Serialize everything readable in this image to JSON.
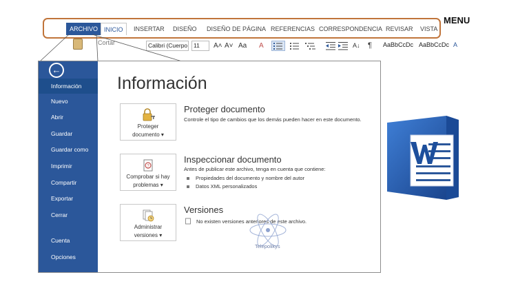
{
  "annotation": {
    "menu_label": "MENU"
  },
  "ribbon": {
    "tabs": [
      {
        "label": "ARCHIVO"
      },
      {
        "label": "INICIO"
      },
      {
        "label": "INSERTAR"
      },
      {
        "label": "DISEÑO"
      },
      {
        "label": "DISEÑO DE PÁGINA"
      },
      {
        "label": "REFERENCIAS"
      },
      {
        "label": "CORRESPONDENCIA"
      },
      {
        "label": "REVISAR"
      },
      {
        "label": "VISTA"
      }
    ],
    "cut_label": "Cortar",
    "font_name": "Calibri (Cuerpo",
    "font_size": "11",
    "grow_font": "A˄",
    "shrink_font": "A˅",
    "change_case": "Aa",
    "clear_format": "A",
    "sort": "A↓",
    "paragraph_mark": "¶",
    "style_1": "AaBbCcDc",
    "style_2": "AaBbCcDc",
    "style_3": "A"
  },
  "backstage": {
    "back_symbol": "←",
    "nav": [
      {
        "label": "Información"
      },
      {
        "label": "Nuevo"
      },
      {
        "label": "Abrir"
      },
      {
        "label": "Guardar"
      },
      {
        "label": "Guardar como"
      },
      {
        "label": "Imprimir"
      },
      {
        "label": "Compartir"
      },
      {
        "label": "Exportar"
      },
      {
        "label": "Cerrar"
      },
      {
        "label": "Cuenta"
      },
      {
        "label": "Opciones"
      }
    ],
    "title": "Información",
    "protect": {
      "button_line1": "Proteger",
      "button_line2": "documento ▾",
      "heading": "Proteger documento",
      "description": "Controle el tipo de cambios que los demás pueden hacer en este documento."
    },
    "inspect": {
      "button_line1": "Comprobar si hay",
      "button_line2": "problemas ▾",
      "heading": "Inspeccionar documento",
      "description": "Antes de publicar este archivo, tenga en cuenta que contiene:",
      "bullets": [
        "Propiedades del documento y nombre del autor",
        "Datos XML personalizados"
      ]
    },
    "versions": {
      "button_line1": "Administrar",
      "button_line2": "versiones ▾",
      "heading": "Versiones",
      "description": "No existen versiones anteriores de este archivo."
    },
    "watermark": "Telepolikys"
  },
  "colors": {
    "word_blue": "#2b579a",
    "annotation_orange": "#c0743a"
  }
}
